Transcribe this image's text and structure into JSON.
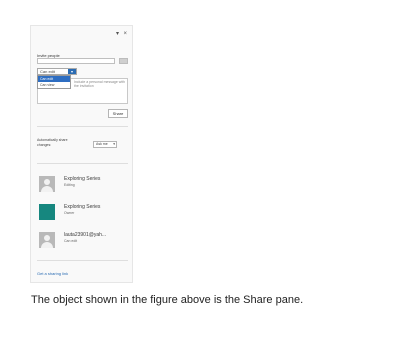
{
  "pane": {
    "window_controls": {
      "dropdown_glyph": "▾",
      "close_glyph": "×"
    },
    "invite": {
      "label": "Invite people",
      "input_value": "",
      "permission_selected": "Can edit",
      "permission_arrow_glyph": "▾",
      "message_placeholder": "Include a personal message with the invitation",
      "permission_options": [
        "Can edit",
        "Can view"
      ],
      "share_button": "Share"
    },
    "auto_share": {
      "label": "Automatically share changes:",
      "value": "Ask me",
      "caret_glyph": "▾"
    },
    "people": [
      {
        "name": "Exploring Series",
        "role": "Editing",
        "avatar": "person-icon"
      },
      {
        "name": "Exploring Series",
        "role": "Owner",
        "avatar": "teal-profile-tile"
      },
      {
        "name": "lauta23901@yah...",
        "role": "Can edit",
        "avatar": "person-icon"
      }
    ],
    "sharing_link": "Get a sharing link"
  },
  "caption": "The object shown in the figure above is the Share pane.",
  "colors": {
    "accent": "#2b6cb3",
    "teal": "#16877f"
  }
}
